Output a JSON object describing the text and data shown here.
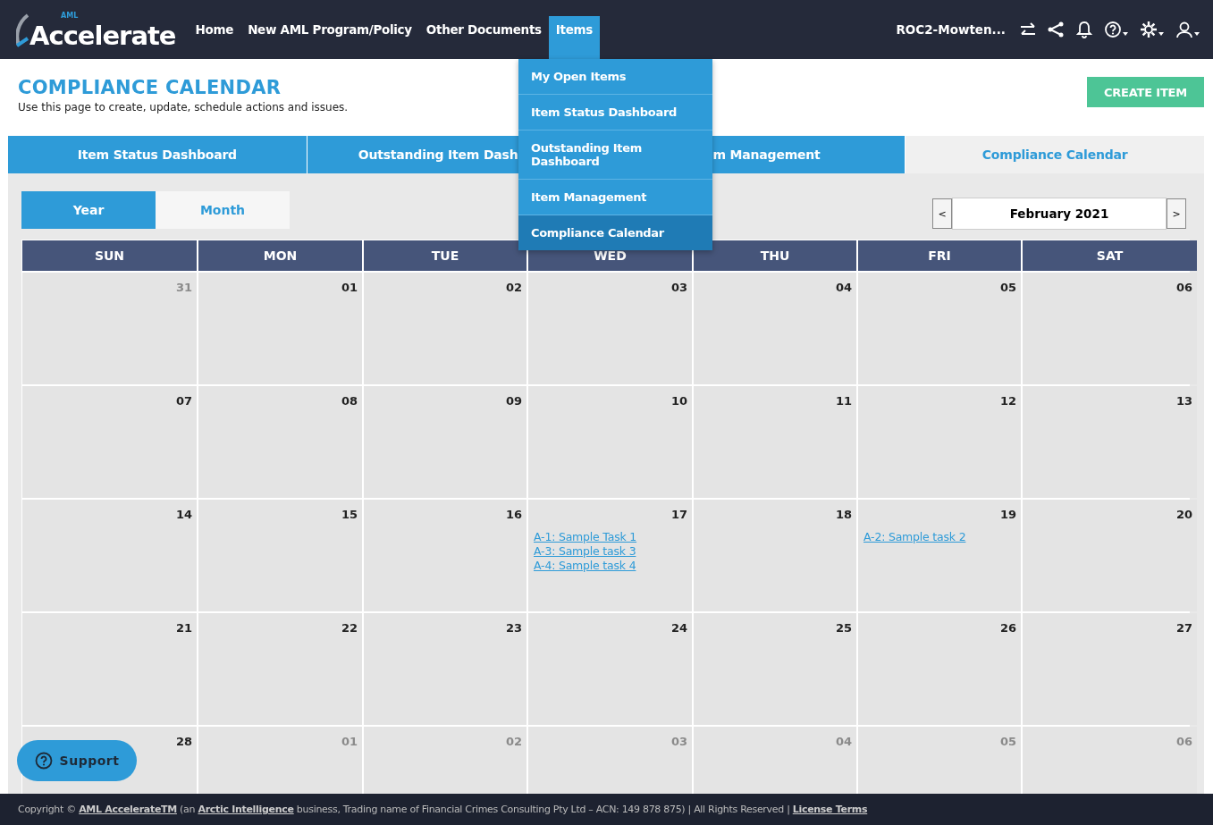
{
  "header": {
    "logo": {
      "small": "AML",
      "name": "Accelerate"
    },
    "nav": [
      {
        "label": "Home",
        "selected": false
      },
      {
        "label": "New AML Program/Policy",
        "selected": false
      },
      {
        "label": "Other Documents",
        "selected": false
      },
      {
        "label": "Items",
        "selected": true
      }
    ],
    "org": "ROC2-Mowten...",
    "icons": [
      {
        "kind": "swap",
        "caret": false
      },
      {
        "kind": "share",
        "caret": false
      },
      {
        "kind": "bell",
        "caret": false
      },
      {
        "kind": "help",
        "caret": true
      },
      {
        "kind": "settings",
        "caret": true
      },
      {
        "kind": "user",
        "caret": true
      }
    ]
  },
  "dropdown": [
    {
      "label": "My Open Items",
      "selected": false
    },
    {
      "label": "Item Status Dashboard",
      "selected": false
    },
    {
      "label": "Outstanding Item Dashboard",
      "selected": false
    },
    {
      "label": "Item Management",
      "selected": false
    },
    {
      "label": "Compliance Calendar",
      "selected": true
    }
  ],
  "page": {
    "title": "COMPLIANCE CALENDAR",
    "subtitle": "Use this page to create, update, schedule actions and issues.",
    "create_button": "CREATE ITEM"
  },
  "tabs": [
    {
      "label": "Item Status Dashboard",
      "selected": false
    },
    {
      "label": "Outstanding Item Dash",
      "selected": false
    },
    {
      "label": "m Management",
      "selected": false
    },
    {
      "label": "Compliance Calendar",
      "selected": true
    }
  ],
  "views": [
    {
      "label": "Year",
      "selected": true
    },
    {
      "label": "Month",
      "selected": false
    }
  ],
  "month_nav": {
    "prev": "<",
    "label": "February 2021",
    "next": ">"
  },
  "weekdays": [
    "SUN",
    "MON",
    "TUE",
    "WED",
    "THU",
    "FRI",
    "SAT"
  ],
  "days": [
    {
      "day": "31",
      "outside": true
    },
    {
      "day": "01",
      "outside": false
    },
    {
      "day": "02",
      "outside": false
    },
    {
      "day": "03",
      "outside": false
    },
    {
      "day": "04",
      "outside": false
    },
    {
      "day": "05",
      "outside": false
    },
    {
      "day": "06",
      "outside": false
    },
    {
      "day": "07",
      "outside": false
    },
    {
      "day": "08",
      "outside": false
    },
    {
      "day": "09",
      "outside": false
    },
    {
      "day": "10",
      "outside": false
    },
    {
      "day": "11",
      "outside": false
    },
    {
      "day": "12",
      "outside": false
    },
    {
      "day": "13",
      "outside": false
    },
    {
      "day": "14",
      "outside": false
    },
    {
      "day": "15",
      "outside": false
    },
    {
      "day": "16",
      "outside": false
    },
    {
      "day": "17",
      "outside": false,
      "events": [
        "A-1: Sample Task 1",
        "A-3: Sample task 3",
        "A-4: Sample task 4"
      ]
    },
    {
      "day": "18",
      "outside": false
    },
    {
      "day": "19",
      "outside": false,
      "events": [
        "A-2: Sample task 2"
      ]
    },
    {
      "day": "20",
      "outside": false
    },
    {
      "day": "21",
      "outside": false
    },
    {
      "day": "22",
      "outside": false
    },
    {
      "day": "23",
      "outside": false
    },
    {
      "day": "24",
      "outside": false
    },
    {
      "day": "25",
      "outside": false
    },
    {
      "day": "26",
      "outside": false
    },
    {
      "day": "27",
      "outside": false
    },
    {
      "day": "28",
      "outside": false
    },
    {
      "day": "01",
      "outside": true
    },
    {
      "day": "02",
      "outside": true
    },
    {
      "day": "03",
      "outside": true
    },
    {
      "day": "04",
      "outside": true
    },
    {
      "day": "05",
      "outside": true
    },
    {
      "day": "06",
      "outside": true
    }
  ],
  "support": "Support",
  "footer": {
    "pre": "Copyright ©",
    "link1": "AML AccelerateTM",
    "mid1": "(an",
    "link2": "Arctic Intelligence",
    "mid2": "business, Trading name of Financial Crimes Consulting Pty Ltd – ACN: 149 878 875) | All Rights Reserved |",
    "link3": "License Terms"
  }
}
